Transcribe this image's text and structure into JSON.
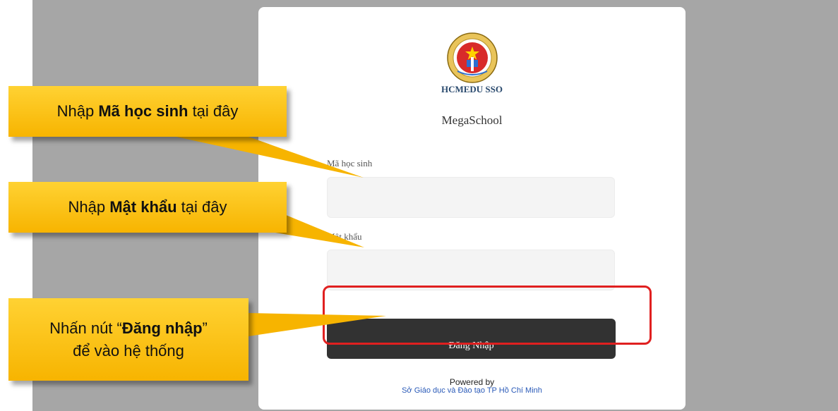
{
  "login": {
    "brand": "HCMEDU SSO",
    "app_name": "MegaSchool",
    "student_id_label": "Mã học sinh",
    "password_label": "Mật khẩu",
    "submit_label": "Đăng Nhập",
    "powered_by": "Powered by",
    "provider": "Sở Giáo dục và Đào tạo TP Hồ Chí Minh",
    "logo_icon": "hcm-department-of-education-emblem-icon",
    "logo_ring_text": "GIÁO DỤC VÀ ĐÀO TẠO"
  },
  "callouts": {
    "student_id": {
      "pre": "Nhập ",
      "bold": "Mã học sinh",
      "post": " tại đây"
    },
    "password": {
      "pre": "Nhập ",
      "bold": "Mật khẩu",
      "post": " tại đây"
    },
    "login": {
      "pre": "Nhấn nút “",
      "bold": "Đăng nhập",
      "post": "”",
      "line2": "để vào hệ thống"
    }
  },
  "colors": {
    "callout": "#f7b400",
    "highlight": "#e02020",
    "button": "#323232",
    "backdrop": "#a6a6a6"
  }
}
